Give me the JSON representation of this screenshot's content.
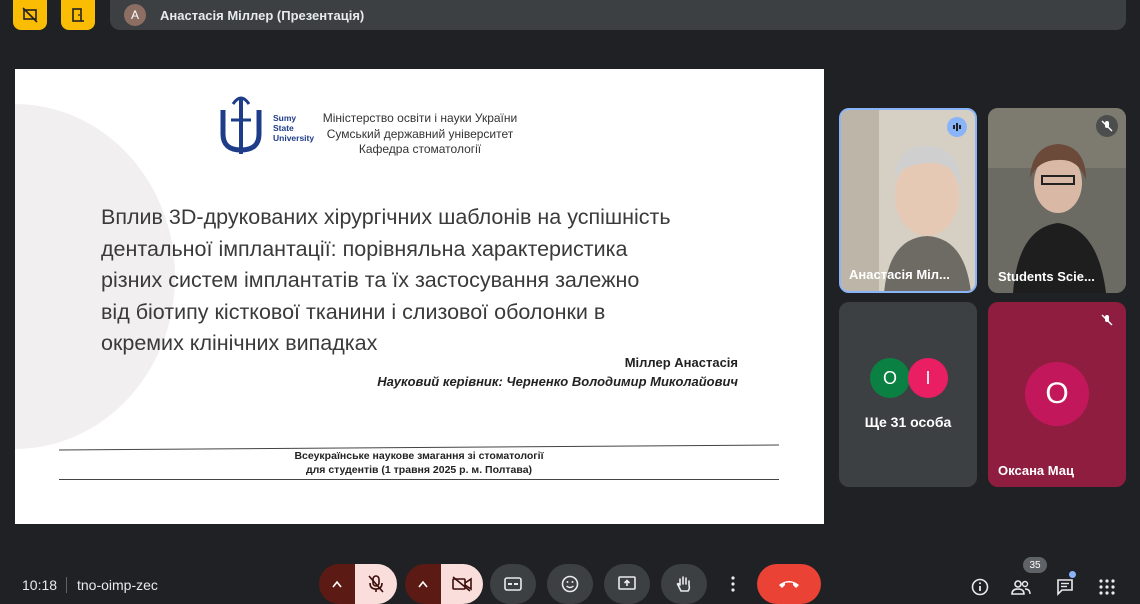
{
  "presenter": {
    "avatar_letter": "А",
    "label": "Анастасія Міллер (Презентація)"
  },
  "slide": {
    "logo_text": [
      "Sumy",
      "State",
      "University"
    ],
    "ministry_lines": [
      "Міністерство освіти і науки України",
      "Сумський державний університет",
      "Кафедра стоматології"
    ],
    "title_lines": [
      "Вплив 3D-друкованих хірургічних шаблонів на успішність",
      "дентальної імплантації: порівняльна характеристика",
      "різних систем імплантатів та їх застосування залежно",
      "від біотипу кісткової тканини і слизової оболонки в",
      "окремих клінічних випадках"
    ],
    "author": "Міллер Анастасія",
    "advisor": "Науковий керівник: Черненко Володимир Миколайович",
    "contest_lines": [
      "Всеукраїнське наукове змагання зі стоматології",
      "для студентів (1 травня 2025 р. м. Полтава)"
    ]
  },
  "participants": {
    "tile1": {
      "name": "Анастасія Міл..."
    },
    "tile2": {
      "name": "Students Scie..."
    },
    "tile3": {
      "avatar1": "О",
      "avatar2": "І",
      "more": "Ще 31 особа"
    },
    "tile4": {
      "avatar": "О",
      "name": "Оксана Мац"
    }
  },
  "bottom": {
    "time": "10:18",
    "meeting_code": "tno-oimp-zec",
    "people_count": "35"
  },
  "colors": {
    "background": "#202124",
    "accent": "#fbbc04",
    "hangup": "#ea4335",
    "muted_bg": "#f9dedc"
  }
}
